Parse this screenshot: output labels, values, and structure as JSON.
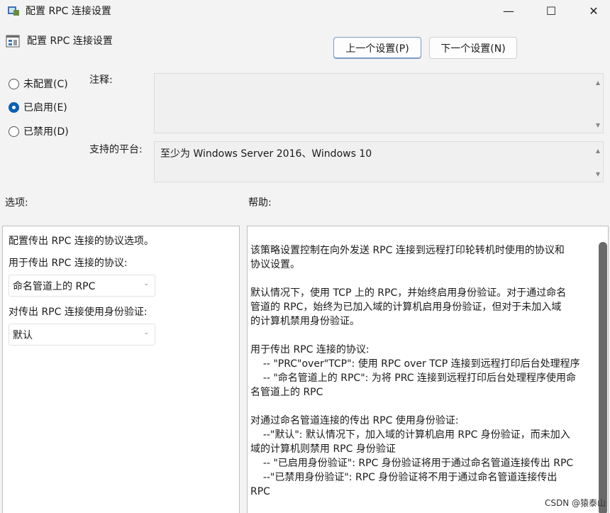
{
  "window": {
    "title": "配置 RPC 连接设置",
    "minimize_glyph": "—",
    "maximize_glyph": "☐",
    "close_glyph": "✕"
  },
  "header": {
    "title": "配置 RPC 连接设置"
  },
  "nav": {
    "prev_label": "上一个设置(P)",
    "next_label": "下一个设置(N)"
  },
  "state": {
    "options": [
      {
        "label": "未配置(C)",
        "selected": false
      },
      {
        "label": "已启用(E)",
        "selected": true
      },
      {
        "label": "已禁用(D)",
        "selected": false
      }
    ]
  },
  "comment": {
    "label": "注释:",
    "value": ""
  },
  "platform": {
    "label": "支持的平台:",
    "value": "至少为 Windows Server 2016、Windows 10"
  },
  "options_section": {
    "heading": "选项:",
    "line1": "配置传出 RPC 连接的协议选项。",
    "protocol_label": "用于传出 RPC 连接的协议:",
    "protocol_value": "命名管道上的 RPC",
    "auth_label": "对传出 RPC 连接使用身份验证:",
    "auth_value": "默认"
  },
  "help_section": {
    "heading": "帮助:",
    "text": "该策略设置控制在向外发送 RPC 连接到远程打印轮转机时使用的协议和\n协议设置。\n\n默认情况下，使用 TCP 上的 RPC，并始终启用身份验证。对于通过命名\n管道的 RPC，始终为已加入域的计算机启用身份验证，但对于未加入域\n的计算机禁用身份验证。\n\n用于传出 RPC 连接的协议:\n    -- \"PRC\"over\"TCP\": 使用 RPC over TCP 连接到远程打印后台处理程序\n    -- \"命名管道上的 RPC\": 为将 PRC 连接到远程打印后台处理程序使用命\n名管道上的 RPC\n\n对通过命名管道连接的传出 RPC 使用身份验证:\n    --\"默认\": 默认情况下，加入域的计算机启用 RPC 身份验证，而未加入\n域的计算机则禁用 RPC 身份验证\n    -- \"已启用身份验证\": RPC 身份验证将用于通过命名管道连接传出 RPC\n    --\"已禁用身份验证\": RPC 身份验证将不用于通过命名管道连接传出\nRPC"
  },
  "watermark": "CSDN @猿泰山",
  "colors": {
    "accent": "#0a5fb4",
    "background": "#f3f3f3"
  }
}
